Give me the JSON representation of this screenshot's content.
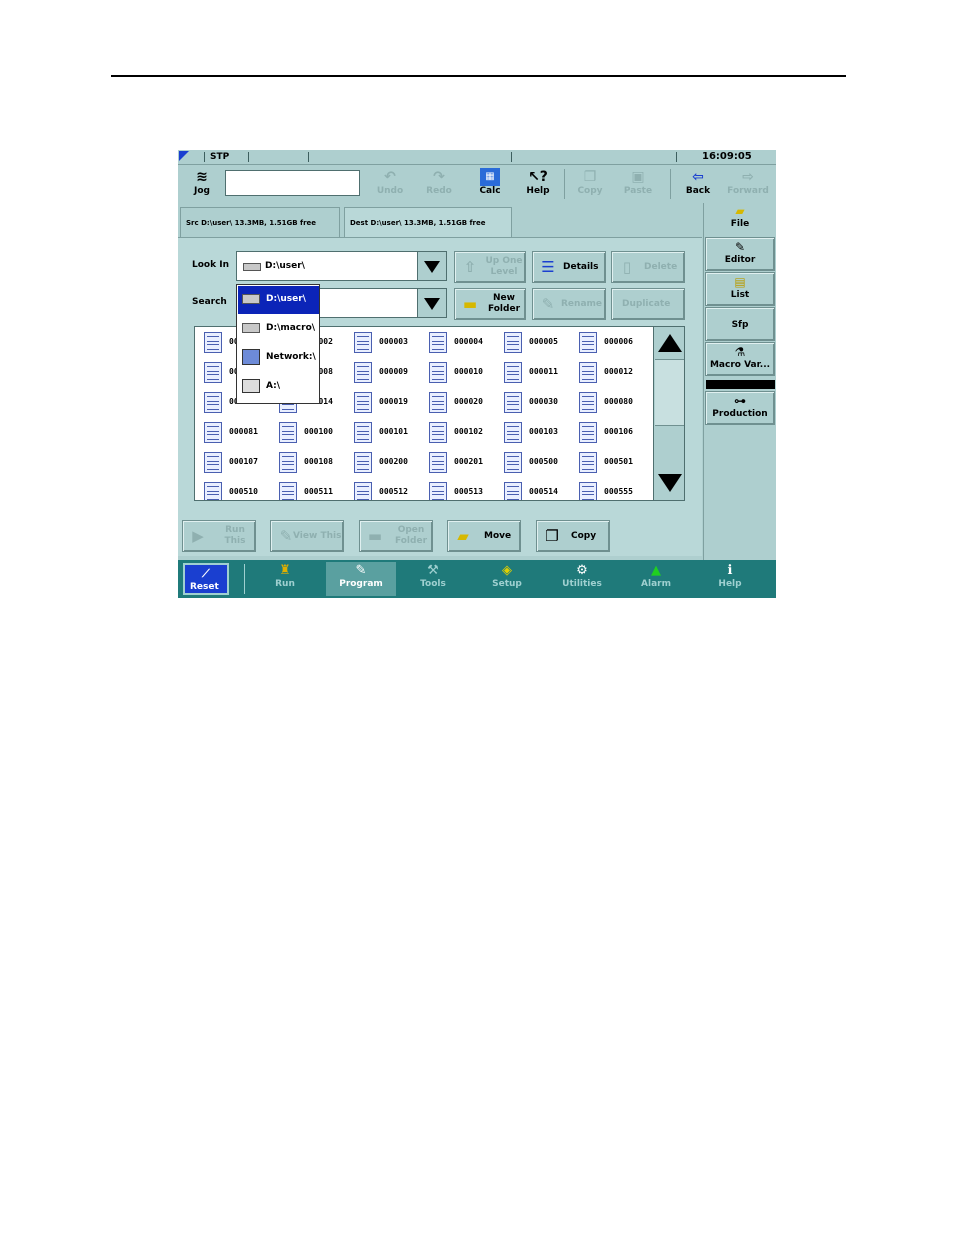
{
  "status_bar": {
    "mode": "STP",
    "time": "16:09:05"
  },
  "toolbar": {
    "jog_label": "Jog",
    "input_value": "",
    "undo": "Undo",
    "redo": "Redo",
    "calc": "Calc",
    "help": "Help",
    "copy": "Copy",
    "paste": "Paste",
    "back": "Back",
    "forward": "Forward"
  },
  "tabs": {
    "src": "Src D:\\user\\   13.3MB, 1.51GB free",
    "dest": "Dest D:\\user\\   13.3MB, 1.51GB free"
  },
  "look_in": {
    "label": "Look In",
    "value": "D:\\user\\"
  },
  "search": {
    "label": "Search",
    "value": ""
  },
  "buttons": {
    "up_one_level": "Up One Level",
    "details": "Details",
    "delete": "Delete",
    "new_folder": "New Folder",
    "rename": "Rename",
    "duplicate": "Duplicate"
  },
  "dropdown_items": [
    "D:\\user\\",
    "D:\\macro\\",
    "Network:\\",
    "A:\\"
  ],
  "files": [
    "000001",
    "000002",
    "000003",
    "000004",
    "000005",
    "000006",
    "000007",
    "000008",
    "000009",
    "000010",
    "000011",
    "000012",
    "000013",
    "000014",
    "000019",
    "000020",
    "000030",
    "000080",
    "000081",
    "000100",
    "000101",
    "000102",
    "000103",
    "000106",
    "000107",
    "000108",
    "000200",
    "000201",
    "000500",
    "000501",
    "000510",
    "000511",
    "000512",
    "000513",
    "000514",
    "000555"
  ],
  "bottom_buttons": {
    "run_this": "Run This",
    "view_this": "View This",
    "open_folder": "Open Folder",
    "move": "Move",
    "copy": "Copy"
  },
  "right_panel": {
    "file": "File",
    "editor": "Editor",
    "list": "List",
    "sfp": "Sfp",
    "macro_var": "Macro Var...",
    "production": "Production"
  },
  "nav": {
    "reset": "Reset",
    "run": "Run",
    "program": "Program",
    "tools": "Tools",
    "setup": "Setup",
    "utilities": "Utilities",
    "alarm": "Alarm",
    "help": "Help"
  },
  "colors": {
    "background": "#aecfcf",
    "nav_bar": "#1f7a7a",
    "selection": "#0b24b8",
    "reset": "#1a3fd0"
  }
}
